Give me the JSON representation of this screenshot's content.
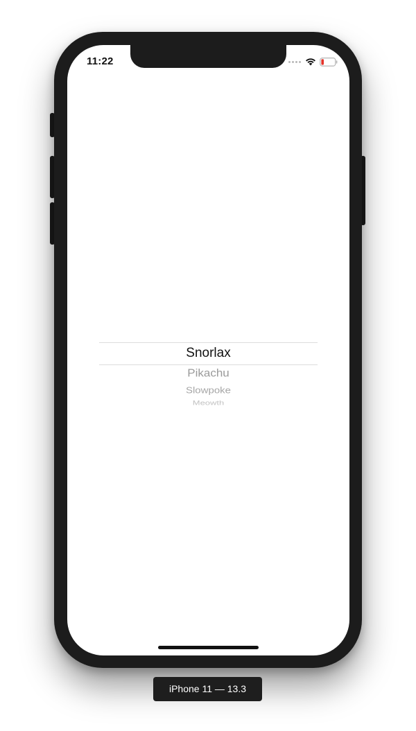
{
  "device": {
    "label": "iPhone 11 — 13.3"
  },
  "status_bar": {
    "time": "11:22",
    "icons": [
      "cellular-signal-icon",
      "wifi-icon",
      "battery-low-icon"
    ],
    "battery_color": "#e5332a"
  },
  "picker": {
    "selected": "Snorlax",
    "items": [
      "Snorlax",
      "Pikachu",
      "Slowpoke",
      "Meowth"
    ]
  },
  "colors": {
    "frame": "#1c1c1c",
    "screen": "#ffffff",
    "selected_text": "#111111",
    "unselected_text": "#9a9a9a"
  }
}
